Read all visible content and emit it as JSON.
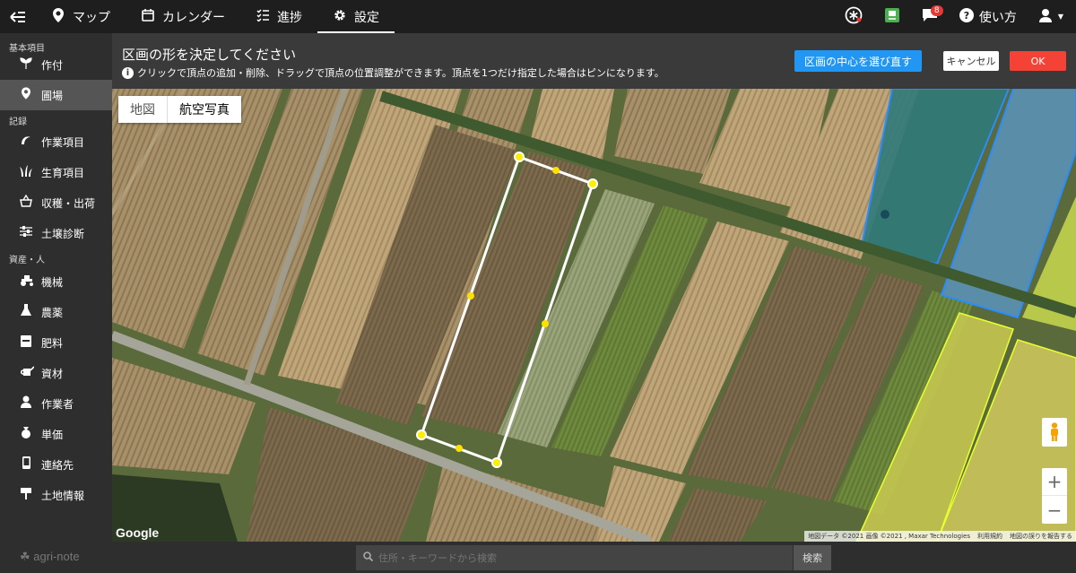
{
  "topbar": {
    "tabs": [
      {
        "label": "マップ",
        "icon": "map-pin-icon"
      },
      {
        "label": "カレンダー",
        "icon": "calendar-icon"
      },
      {
        "label": "進捗",
        "icon": "checklist-icon"
      },
      {
        "label": "設定",
        "icon": "gear-icon"
      }
    ],
    "active_tab": "設定",
    "notification_count": "8",
    "help_label": "使い方"
  },
  "sidebar": {
    "sections": [
      {
        "title": "基本項目",
        "items": [
          "作付",
          "圃場"
        ]
      },
      {
        "title": "記録",
        "items": [
          "作業項目",
          "生育項目",
          "収穫・出荷",
          "土壌診断"
        ]
      },
      {
        "title": "資産・人",
        "items": [
          "機械",
          "農薬",
          "肥料",
          "資材",
          "作業者",
          "単価",
          "連絡先",
          "土地情報"
        ]
      }
    ],
    "active_item": "圃場",
    "logo": "agri-note"
  },
  "header": {
    "title": "区画の形を決定してください",
    "hint": "クリックで頂点の追加・削除、ドラッグで頂点の位置調整ができます。頂点を1つだけ指定した場合はピンになります。",
    "reselect_label": "区画の中心を選び直す",
    "cancel_label": "キャンセル",
    "ok_label": "OK"
  },
  "map": {
    "type_buttons": [
      "地図",
      "航空写真"
    ],
    "selected_type": "航空写真",
    "google_label": "Google",
    "attribution": [
      "地図データ ©2021 画像 ©2021 , Maxar Technologies",
      "利用規約",
      "地図の誤りを報告する"
    ],
    "zoom_in": "+",
    "zoom_out": "−"
  },
  "search": {
    "placeholder": "住所・キーワードから検索",
    "button_label": "検索"
  },
  "colors": {
    "accent_blue": "#2196f3",
    "ok_red": "#f44336",
    "polygon_stroke": "#ffffff",
    "vertex": "#ffee00"
  }
}
